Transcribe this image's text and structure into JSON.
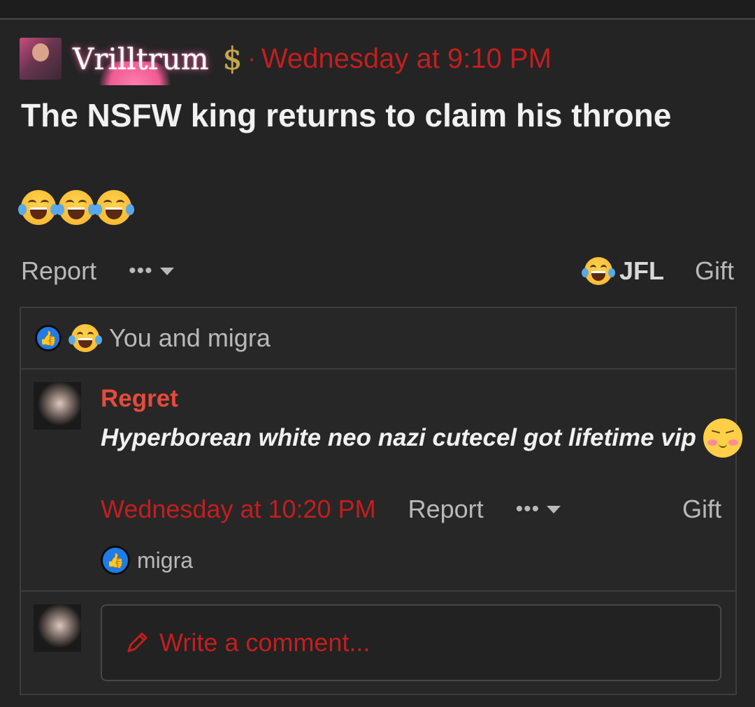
{
  "post": {
    "author": "Vrilltrum",
    "badge": "$",
    "separator": "·",
    "timestamp": "Wednesday at 9:10 PM",
    "title": "The NSFW king returns to claim his throne",
    "emojis": [
      "laughing-crying",
      "laughing-crying",
      "laughing-crying"
    ],
    "actions": {
      "report": "Report",
      "more": "•••",
      "reaction_label": "JFL",
      "gift": "Gift"
    },
    "reactions_summary": "You and migra"
  },
  "comment": {
    "author": "Regret",
    "text": "Hyperborean white neo nazi cutecel got lifetime vip",
    "timestamp": "Wednesday at 10:20 PM",
    "report": "Report",
    "more": "•••",
    "gift": "Gift",
    "likes": "migra"
  },
  "reply": {
    "placeholder": "Write a comment..."
  },
  "colors": {
    "background": "#242424",
    "accent_red": "#c41e1e",
    "author_red": "#e64a3c",
    "like_blue": "#1f7be6"
  }
}
